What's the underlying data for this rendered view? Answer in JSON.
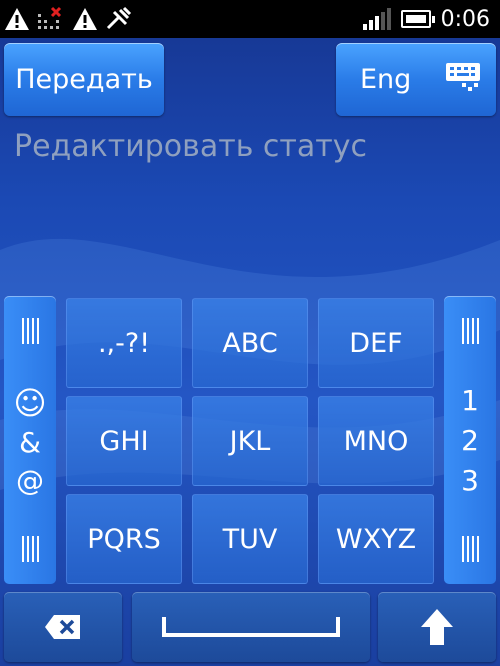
{
  "statusbar": {
    "time": "0:06",
    "icons": [
      "warning-icon",
      "data-off-icon",
      "warning-icon",
      "usb-debug-icon",
      "signal-icon",
      "battery-icon"
    ],
    "signal_level": 3
  },
  "header": {
    "send_label": "Передать",
    "lang_label": "Eng",
    "lang_icon": "keyboard-settings-icon"
  },
  "status_input": {
    "placeholder": "Редактировать статус",
    "value": ""
  },
  "keypad": {
    "left_panel": {
      "symbols": [
        "☺",
        "&",
        "@"
      ]
    },
    "right_panel": {
      "numbers": [
        "1",
        "2",
        "3"
      ]
    },
    "keys": [
      {
        "label": ".,-?!"
      },
      {
        "label": "ABC"
      },
      {
        "label": "DEF"
      },
      {
        "label": "GHI"
      },
      {
        "label": "JKL"
      },
      {
        "label": "MNO"
      },
      {
        "label": "PQRS"
      },
      {
        "label": "TUV"
      },
      {
        "label": "WXYZ"
      }
    ]
  },
  "bottom_row": {
    "backspace_icon": "backspace-icon",
    "space_icon": "space-icon",
    "shift_icon": "shift-up-arrow-icon"
  },
  "colors": {
    "accent": "#2a7ce8",
    "background": "#1b49b4",
    "placeholder": "#8fa0bf"
  }
}
